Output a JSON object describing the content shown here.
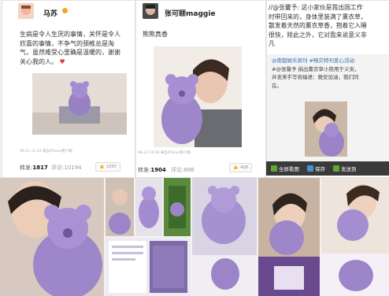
{
  "posts": [
    {
      "username": "马苏",
      "text_lines": [
        "生病是令人生厌的事情，关怀是令人",
        "欣喜的事情，不争气的颈椎总是淘",
        "气，虽然难受心里确是温暖的，谢谢",
        "关心我的人。"
      ],
      "meta": "09-11 11:23  来自iPhone客户端",
      "repost_label": "转发:",
      "repost_count": "1817",
      "comment_label": "评论:",
      "comment_count": "10194",
      "like_count": "1037"
    },
    {
      "username": "张可颐maggie",
      "text_lines": [
        "熊熊真香"
      ],
      "meta": "09-23 19:35  来自iPhone客户端",
      "repost_label": "转发:",
      "repost_count": "1904",
      "comment_label": "评论:",
      "comment_count": "886",
      "like_count": "428"
    },
    {
      "text_lines": [
        "//@张馨予: 这小家伙是我出国工作",
        "时带回来的，身体里装满了薰衣草，",
        "散发着天然的薰衣草香，抱着它入睡",
        "很快，除此之外，它对我来说意义非",
        "凡"
      ],
      "quote_lines": [
        "@南都娱乐周刊 #畅灾特刊爱心活动",
        "#@张馨予 捐出薰衣草小熊用于义卖，",
        "并发来手写祝福语：雅安加油，我们同",
        "在。"
      ]
    }
  ],
  "overlay": {
    "view_original": "全屏看图",
    "save": "保存",
    "send": "发送到"
  },
  "icons": [
    "heart-icon",
    "thumbs-up-icon",
    "fullscreen-icon",
    "save-icon",
    "send-icon",
    "verified-badge-icon"
  ],
  "colors": {
    "link": "#3a6fb8",
    "bear": "#9b86c9",
    "overlay_bg": "#3a3a3a"
  }
}
